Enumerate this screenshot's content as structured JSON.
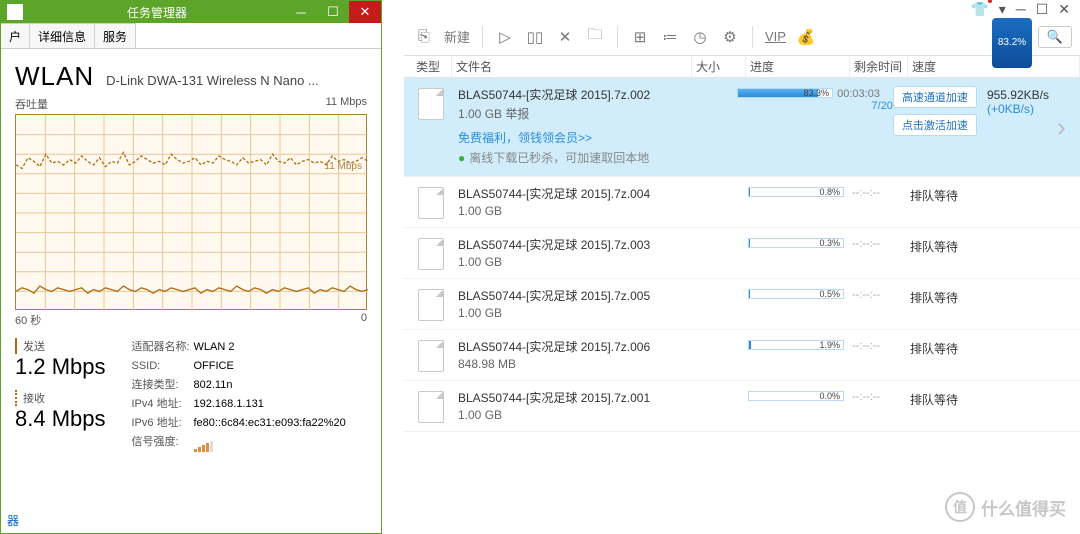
{
  "taskman": {
    "title": "任务管理器",
    "tabs": {
      "t0": "户",
      "t1": "详细信息",
      "t2": "服务"
    },
    "wlan": "WLAN",
    "adapter": "D-Link DWA-131 Wireless N Nano ...",
    "throughput_label": "吞吐量",
    "graph_max": "11 Mbps",
    "graph_inline": "11 Mbps",
    "axis_left": "60 秒",
    "axis_right": "0",
    "send_label": "发送",
    "send_value": "1.2 Mbps",
    "recv_label": "接收",
    "recv_value": "8.4 Mbps",
    "info": {
      "k_adapter": "适配器名称:",
      "v_adapter": "WLAN 2",
      "k_ssid": "SSID:",
      "v_ssid": "OFFICE",
      "k_conn": "连接类型:",
      "v_conn": "802.11n",
      "k_ip4": "IPv4 地址:",
      "v_ip4": "192.168.1.131",
      "k_ip6": "IPv6 地址:",
      "v_ip6": "fe80::6c84:ec31:e093:fa22%20",
      "k_sig": "信号强度:"
    },
    "footer": "器"
  },
  "dlm": {
    "toolbar": {
      "new": "新建",
      "vip": "VIP"
    },
    "phone_pct": "83.2%",
    "columns": {
      "type": "类型",
      "name": "文件名",
      "size": "大小",
      "prog": "进度",
      "eta": "剩余时间",
      "speed": "速度"
    },
    "items": [
      {
        "name": "BLAS50744-[实况足球 2015].7z.002",
        "size": "1.00 GB",
        "size_suffix": "举报",
        "progress_pct": 83.3,
        "progress_txt": "83.3%",
        "eta": "00:03:03",
        "eta2": "7/20",
        "speed": "955.92KB/s",
        "speed_plus": "(+0KB/s)",
        "btn1": "高速通道加速",
        "btn2": "点击激活加速",
        "note1": "免费福利，领钱领会员",
        "note1_link": ">>",
        "note2_ok": "●",
        "note2": "离线下载已秒杀，可加速取回本地"
      },
      {
        "name": "BLAS50744-[实况足球 2015].7z.004",
        "size": "1.00 GB",
        "progress_pct": 0.8,
        "progress_txt": "0.8%",
        "eta": "--:--:--",
        "speed": "排队等待"
      },
      {
        "name": "BLAS50744-[实况足球 2015].7z.003",
        "size": "1.00 GB",
        "progress_pct": 0.3,
        "progress_txt": "0.3%",
        "eta": "--:--:--",
        "speed": "排队等待"
      },
      {
        "name": "BLAS50744-[实况足球 2015].7z.005",
        "size": "1.00 GB",
        "progress_pct": 0.5,
        "progress_txt": "0.5%",
        "eta": "--:--:--",
        "speed": "排队等待"
      },
      {
        "name": "BLAS50744-[实况足球 2015].7z.006",
        "size": "848.98 MB",
        "progress_pct": 1.9,
        "progress_txt": "1.9%",
        "eta": "--:--:--",
        "speed": "排队等待"
      },
      {
        "name": "BLAS50744-[实况足球 2015].7z.001",
        "size": "1.00 GB",
        "progress_pct": 0.0,
        "progress_txt": "0.0%",
        "eta": "--:--:--",
        "speed": "排队等待"
      }
    ]
  },
  "watermark": "什么值得买",
  "chart_data": {
    "type": "line",
    "title": "WLAN 吞吐量",
    "xlabel": "秒",
    "ylabel": "Mbps",
    "xlim": [
      0,
      60
    ],
    "ylim": [
      0,
      11
    ],
    "series": [
      {
        "name": "接收",
        "values": [
          8.2,
          8.0,
          8.6,
          8.4,
          8.1,
          8.8,
          8.3,
          8.4,
          8.2,
          8.5,
          8.3,
          8.7,
          8.4,
          8.2,
          8.6,
          8.1,
          8.4,
          8.3,
          8.9,
          8.2,
          8.4,
          8.7,
          8.5,
          8.3,
          8.4,
          8.2,
          8.8,
          8.5,
          8.3,
          8.4,
          8.6,
          8.2,
          8.4,
          8.3,
          8.7,
          8.5,
          8.4,
          8.2,
          8.6,
          8.3,
          8.4,
          8.5,
          8.2,
          8.8,
          8.4,
          8.3,
          8.6,
          8.2,
          8.4,
          8.5,
          8.3,
          8.4,
          8.2,
          8.7,
          8.4,
          8.5,
          8.3,
          8.4,
          8.6,
          8.4
        ]
      },
      {
        "name": "发送",
        "values": [
          1.1,
          1.3,
          1.2,
          1.0,
          1.4,
          1.2,
          1.1,
          1.3,
          1.2,
          1.1,
          1.2,
          1.3,
          1.0,
          1.2,
          1.1,
          1.3,
          1.2,
          1.1,
          1.4,
          1.2,
          1.1,
          1.3,
          1.2,
          1.0,
          1.2,
          1.1,
          1.3,
          1.2,
          1.1,
          1.2,
          1.3,
          1.0,
          1.2,
          1.1,
          1.3,
          1.2,
          1.1,
          1.4,
          1.2,
          1.1,
          1.3,
          1.2,
          1.0,
          1.2,
          1.1,
          1.3,
          1.2,
          1.1,
          1.2,
          1.3,
          1.0,
          1.2,
          1.1,
          1.3,
          1.2,
          1.1,
          1.4,
          1.2,
          1.1,
          1.2
        ]
      }
    ]
  }
}
